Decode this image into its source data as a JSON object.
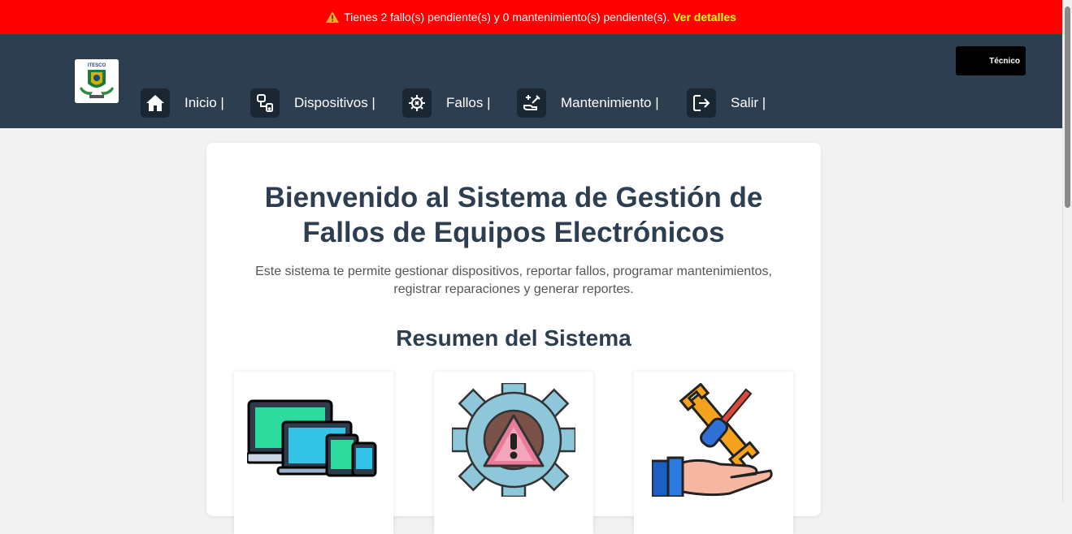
{
  "alert": {
    "icon": "warning-icon",
    "message": "Tienes 2 fallo(s) pendiente(s) y 0 mantenimiento(s) pendiente(s).",
    "link_label": "Ver detalles"
  },
  "header": {
    "logo_icon": "itesco-logo",
    "logo_text": "ITESCO",
    "role_label": "Técnico",
    "nav": [
      {
        "label": "Inicio |",
        "icon": "home-icon"
      },
      {
        "label": "Dispositivos |",
        "icon": "devices-icon"
      },
      {
        "label": "Fallos |",
        "icon": "faults-icon"
      },
      {
        "label": "Mantenimiento |",
        "icon": "maintenance-icon"
      },
      {
        "label": "Salir |",
        "icon": "logout-icon"
      }
    ]
  },
  "main": {
    "title_line1": "Bienvenido al Sistema de Gestión de",
    "title_line2": "Fallos de Equipos Electrónicos",
    "description_line1": "Este sistema te permite gestionar dispositivos, reportar fallos, programar mantenimientos,",
    "description_line2": "registrar reparaciones y generar reportes.",
    "summary_title": "Resumen del Sistema",
    "cards": [
      {
        "icon": "devices-illustration-icon"
      },
      {
        "icon": "fault-gear-warning-icon"
      },
      {
        "icon": "repair-tools-hand-icon"
      }
    ]
  },
  "colors": {
    "alert_bg": "#ff0000",
    "alert_link": "#ffff00",
    "navbar_bg": "#2c3e50",
    "title_color": "#2c3e50"
  }
}
